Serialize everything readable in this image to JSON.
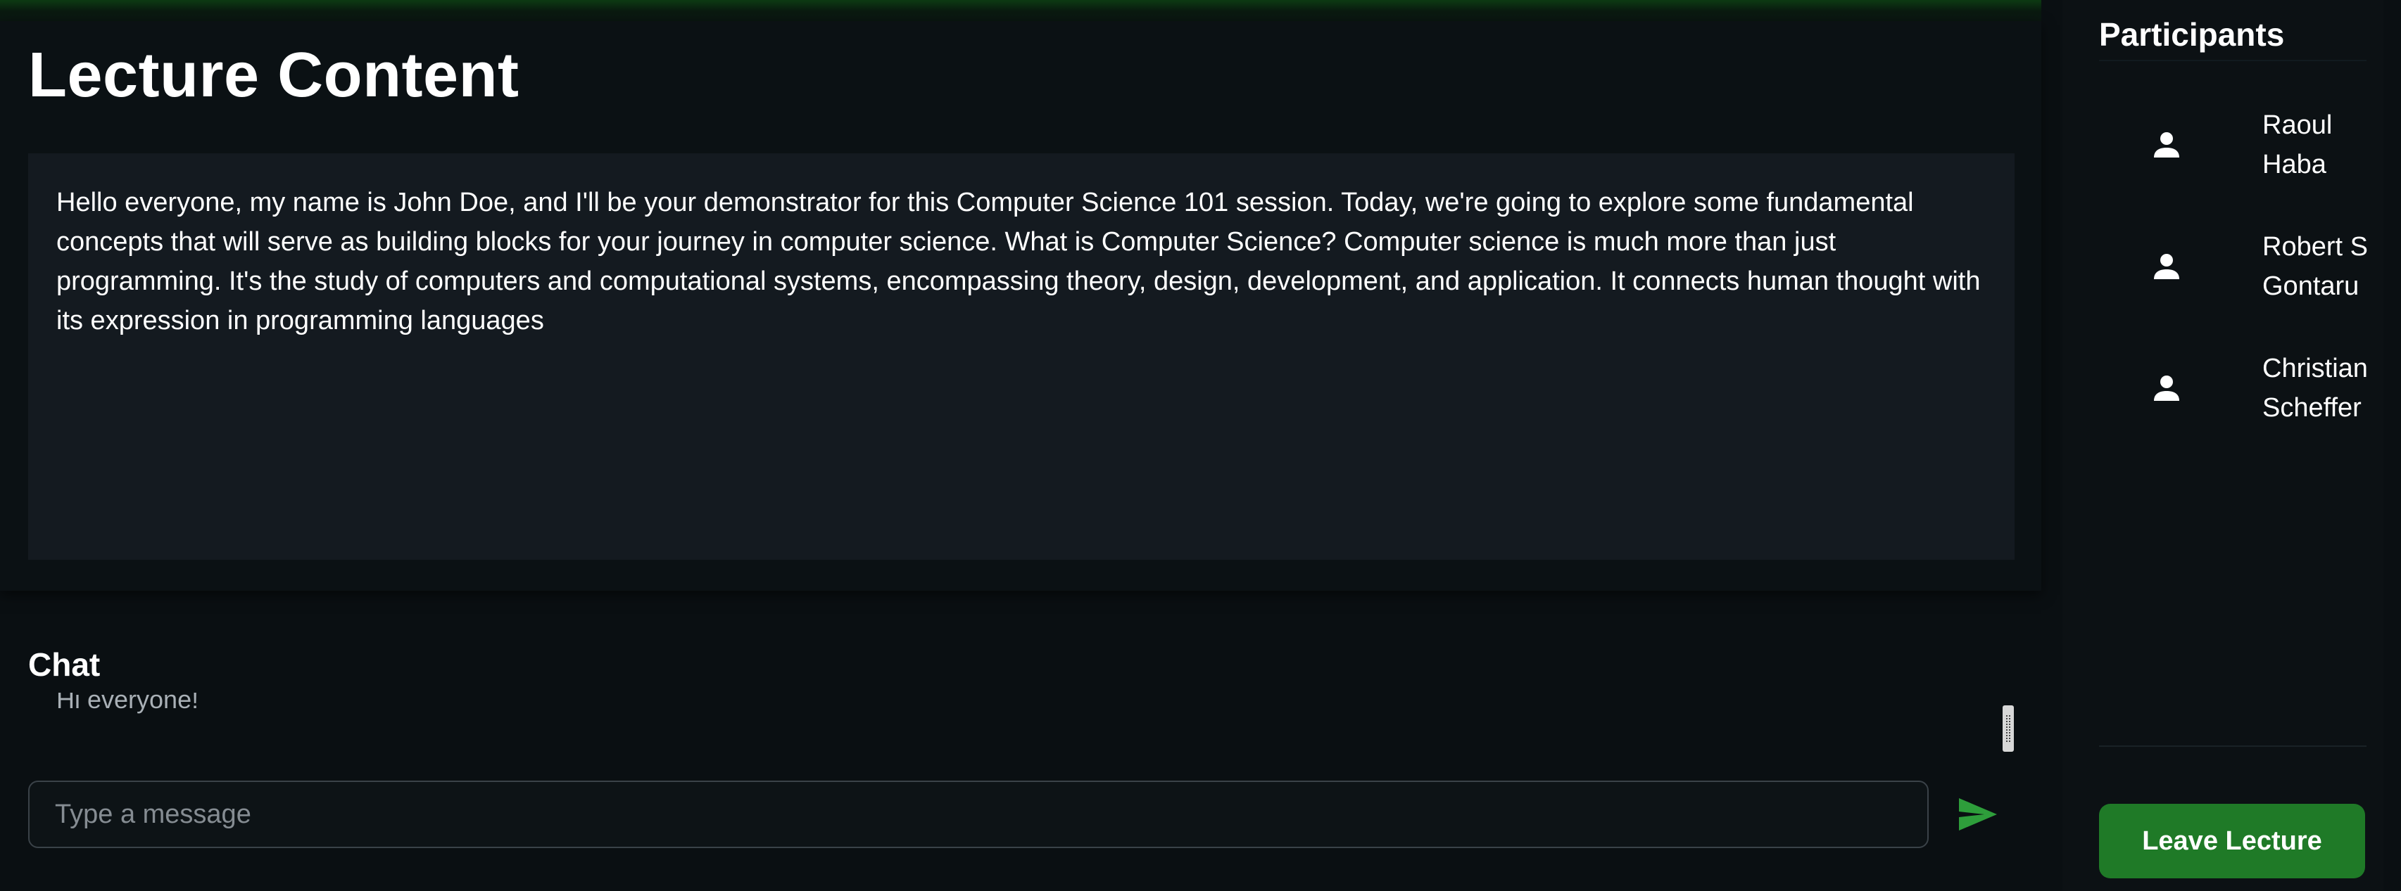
{
  "lecture": {
    "title": "Lecture Content",
    "content": "Hello everyone, my name is John Doe, and I'll be your demonstrator for this Computer Science 101 session. Today, we're going to explore some fundamental concepts that will serve as building blocks for your journey in computer science. What is Computer Science? Computer science is much more than just programming. It's the study of computers and computational systems, encompassing theory, design, development, and application. It connects human thought with its expression in programming languages"
  },
  "chat": {
    "title": "Chat",
    "messages": [
      "Hi everyone!"
    ],
    "input_placeholder": "Type a message",
    "input_value": ""
  },
  "participants": {
    "title": "Participants",
    "items": [
      {
        "name": "Raoul Haba"
      },
      {
        "name": "Robert S Gontaru"
      },
      {
        "name": "Christian Scheffer"
      }
    ]
  },
  "actions": {
    "leave_label": "Leave Lecture"
  },
  "colors": {
    "background": "#0a0f12",
    "content_box": "#141a20",
    "accent_green": "#1f7a27",
    "send_icon": "#2e9e3b"
  },
  "icons": {
    "send": "send-icon",
    "participant": "person-icon"
  }
}
